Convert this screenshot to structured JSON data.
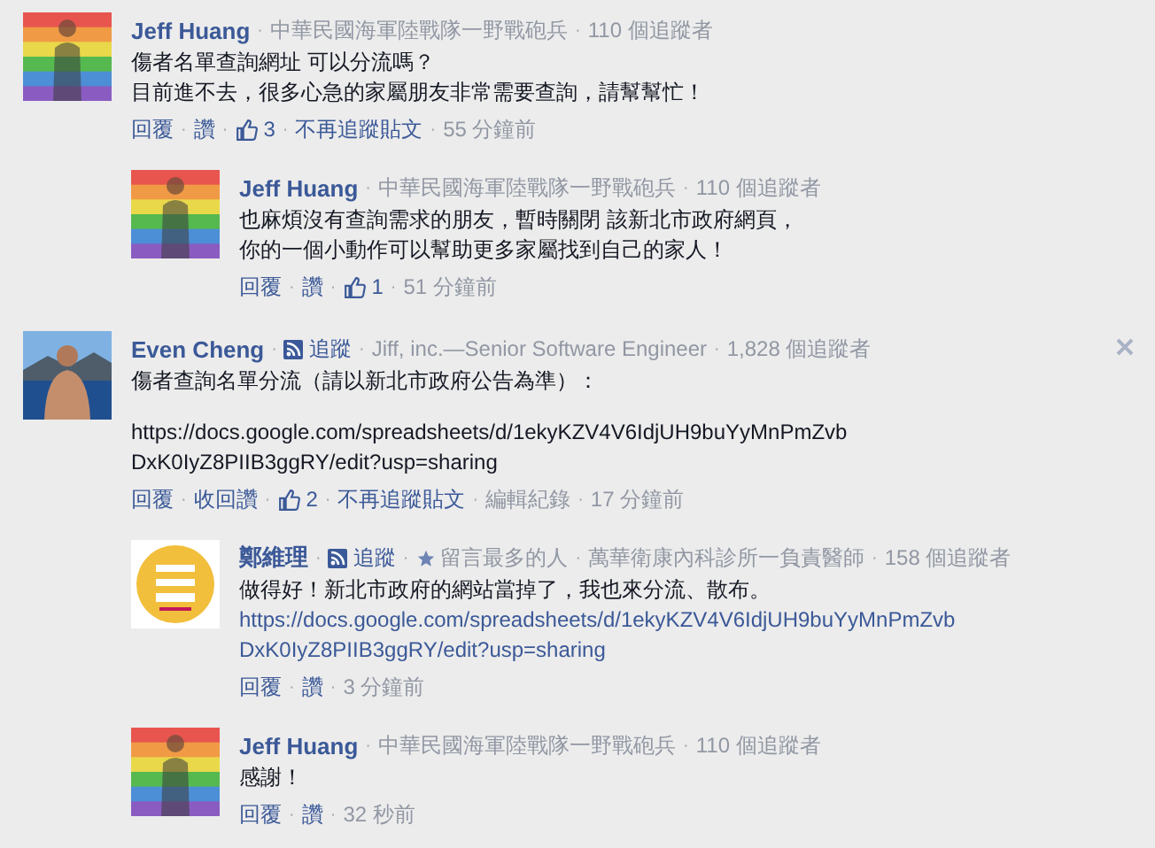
{
  "comments": [
    {
      "author": "Jeff Huang",
      "meta": [
        {
          "sep": "·",
          "kind": "text",
          "text": "中華民國海軍陸戰隊一野戰砲兵"
        },
        {
          "sep": "·",
          "kind": "text",
          "text": "110 個追蹤者"
        }
      ],
      "closable": false,
      "body": [
        {
          "kind": "text",
          "lines": [
            "傷者名單查詢網址 可以分流嗎？",
            "目前進不去，很多心急的家屬朋友非常需要查詢，請幫幫忙！"
          ]
        }
      ],
      "actions": [
        {
          "kind": "link",
          "text": "回覆"
        },
        {
          "sep": "·",
          "kind": "link",
          "text": "讚"
        },
        {
          "sep": "·",
          "kind": "like",
          "text": "3"
        },
        {
          "sep": "·",
          "kind": "link",
          "text": "不再追蹤貼文"
        },
        {
          "sep": "·",
          "kind": "time",
          "text": "55 分鐘前"
        }
      ],
      "replies": [
        {
          "author": "Jeff Huang",
          "meta": [
            {
              "sep": "·",
              "kind": "text",
              "text": "中華民國海軍陸戰隊一野戰砲兵"
            },
            {
              "sep": "·",
              "kind": "text",
              "text": "110 個追蹤者"
            }
          ],
          "body": [
            {
              "kind": "text",
              "lines": [
                "也麻煩沒有查詢需求的朋友，暫時關閉 該新北市政府網頁，",
                "你的一個小動作可以幫助更多家屬找到自己的家人！"
              ]
            }
          ],
          "actions": [
            {
              "kind": "link",
              "text": "回覆"
            },
            {
              "sep": "·",
              "kind": "link",
              "text": "讚"
            },
            {
              "sep": "·",
              "kind": "like",
              "text": "1"
            },
            {
              "sep": "·",
              "kind": "time",
              "text": "51 分鐘前"
            }
          ]
        }
      ]
    },
    {
      "author": "Even Cheng",
      "meta": [
        {
          "sep": "·",
          "kind": "follow",
          "text": "追蹤"
        },
        {
          "sep": "·",
          "kind": "text",
          "text": "Jiff, inc.—Senior Software Engineer"
        },
        {
          "sep": "·",
          "kind": "text",
          "text": "1,828 個追蹤者"
        }
      ],
      "closable": true,
      "body": [
        {
          "kind": "text",
          "lines": [
            "傷者查詢名單分流（請以新北市政府公告為準）："
          ]
        },
        {
          "kind": "text",
          "lines": [
            "https://docs.google.com/spreadsheets/d/1ekyKZV4V6IdjUH9buYyMnPmZvb",
            "DxK0IyZ8PIIB3ggRY/edit?usp=sharing"
          ]
        }
      ],
      "actions": [
        {
          "kind": "link",
          "text": "回覆"
        },
        {
          "sep": "·",
          "kind": "link",
          "text": "收回讚"
        },
        {
          "sep": "·",
          "kind": "like",
          "text": "2"
        },
        {
          "sep": "·",
          "kind": "link",
          "text": "不再追蹤貼文"
        },
        {
          "sep": "·",
          "kind": "time",
          "text": "編輯紀錄"
        },
        {
          "sep": "·",
          "kind": "time",
          "text": "17 分鐘前"
        }
      ],
      "replies": [
        {
          "author": "鄭維理",
          "meta": [
            {
              "sep": "·",
              "kind": "follow",
              "text": "追蹤"
            },
            {
              "sep": "·",
              "kind": "star",
              "text": "留言最多的人"
            },
            {
              "sep": "·",
              "kind": "text",
              "text": "萬華衛康內科診所一負責醫師"
            },
            {
              "sep": "·",
              "kind": "text",
              "text": "158 個追蹤者"
            }
          ],
          "body": [
            {
              "kind": "text",
              "lines": [
                "做得好！新北市政府的網站當掉了，我也來分流、散布。"
              ]
            },
            {
              "kind": "link",
              "lines": [
                "https://docs.google.com/spreadsheets/d/1ekyKZV4V6IdjUH9buYyMnPmZvb",
                "DxK0IyZ8PIIB3ggRY/edit?usp=sharing"
              ]
            }
          ],
          "actions": [
            {
              "kind": "link",
              "text": "回覆"
            },
            {
              "sep": "·",
              "kind": "link",
              "text": "讚"
            },
            {
              "sep": "·",
              "kind": "time",
              "text": "3 分鐘前"
            }
          ]
        },
        {
          "author": "Jeff Huang",
          "meta": [
            {
              "sep": "·",
              "kind": "text",
              "text": "中華民國海軍陸戰隊一野戰砲兵"
            },
            {
              "sep": "·",
              "kind": "text",
              "text": "110 個追蹤者"
            }
          ],
          "body": [
            {
              "kind": "text",
              "lines": [
                "感謝！"
              ]
            }
          ],
          "actions": [
            {
              "kind": "link",
              "text": "回覆"
            },
            {
              "sep": "·",
              "kind": "link",
              "text": "讚"
            },
            {
              "sep": "·",
              "kind": "time",
              "text": "32 秒前"
            }
          ]
        }
      ]
    }
  ]
}
